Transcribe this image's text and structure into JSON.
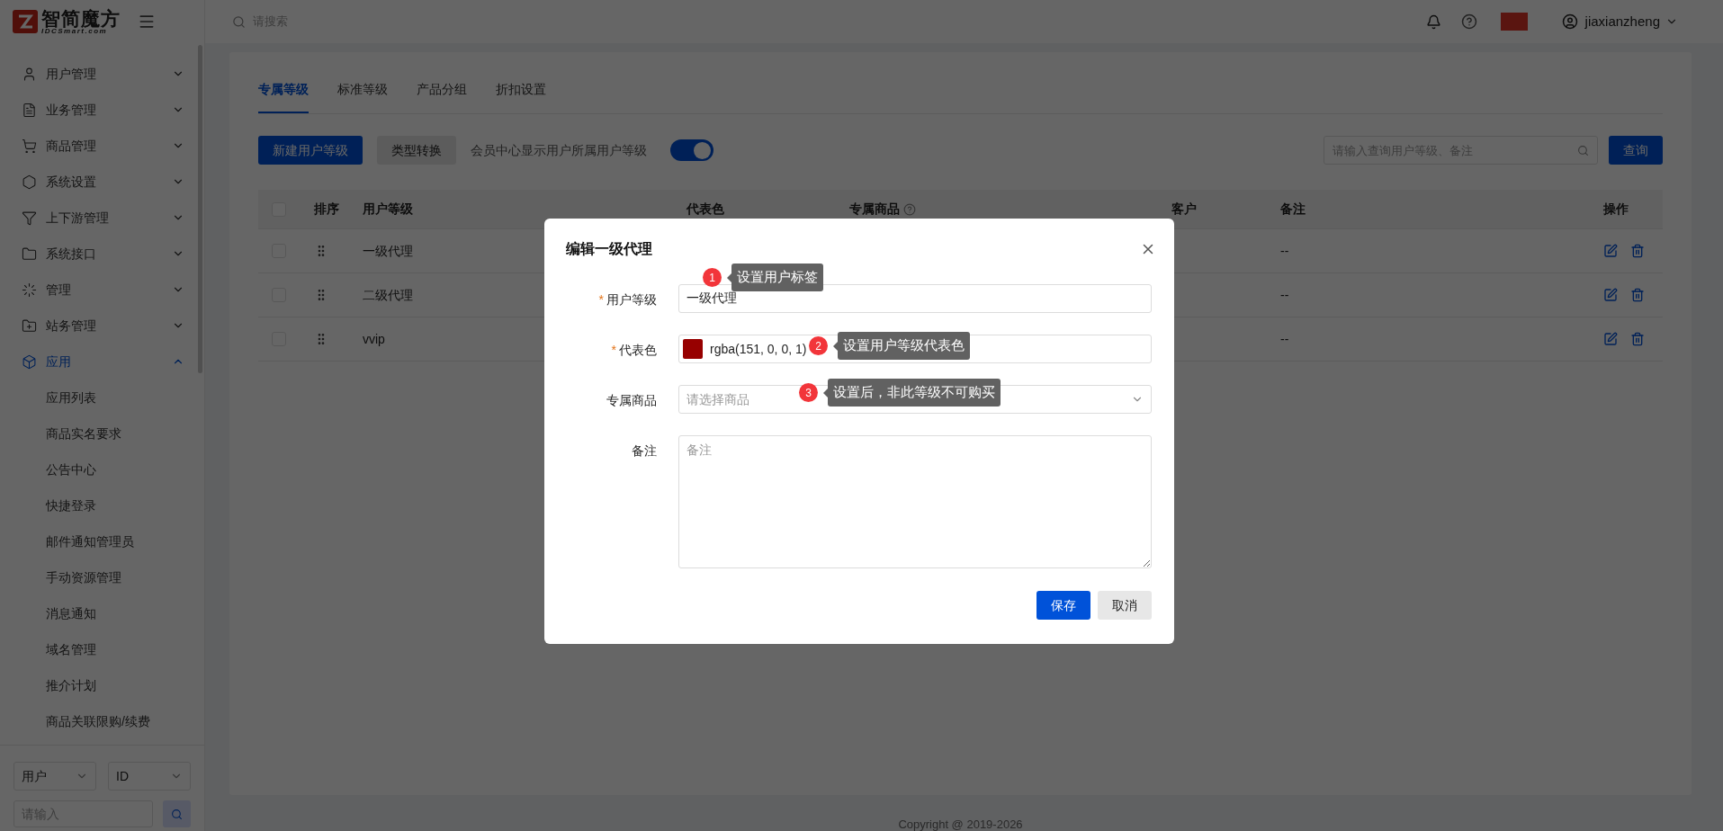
{
  "header": {
    "logo_text": "智简魔方",
    "logo_subtext": "IDCSmart.com",
    "search_placeholder": "请搜索",
    "username": "jiaxianzheng"
  },
  "sidebar": {
    "items": [
      {
        "kind": "user",
        "label": "用户管理",
        "expanded": false,
        "selected": false
      },
      {
        "kind": "list",
        "label": "业务管理",
        "expanded": false,
        "selected": false
      },
      {
        "kind": "cart",
        "label": "商品管理",
        "expanded": false,
        "selected": false
      },
      {
        "kind": "gear",
        "label": "系统设置",
        "expanded": false,
        "selected": false
      },
      {
        "kind": "filter",
        "label": "上下游管理",
        "expanded": false,
        "selected": false
      },
      {
        "kind": "folder",
        "label": "系统接口",
        "expanded": false,
        "selected": false
      },
      {
        "kind": "burst",
        "label": "管理",
        "expanded": false,
        "selected": false
      },
      {
        "kind": "folder-plus",
        "label": "站务管理",
        "expanded": false,
        "selected": false
      },
      {
        "kind": "cube",
        "label": "应用",
        "expanded": true,
        "selected": true,
        "children": [
          {
            "label": "应用列表",
            "selected": false
          },
          {
            "label": "商品实名要求",
            "selected": false
          },
          {
            "label": "公告中心",
            "selected": false
          },
          {
            "label": "快捷登录",
            "selected": false
          },
          {
            "label": "邮件通知管理员",
            "selected": false
          },
          {
            "label": "手动资源管理",
            "selected": false
          },
          {
            "label": "消息通知",
            "selected": false
          },
          {
            "label": "域名管理",
            "selected": false
          },
          {
            "label": "推介计划",
            "selected": false
          },
          {
            "label": "商品关联限购/续费",
            "selected": false
          }
        ]
      }
    ],
    "filter_type": "用户",
    "filter_field": "ID",
    "filter_placeholder": "请输入"
  },
  "tabs": [
    {
      "label": "专属等级",
      "selected": true
    },
    {
      "label": "标准等级",
      "selected": false
    },
    {
      "label": "产品分组",
      "selected": false
    },
    {
      "label": "折扣设置",
      "selected": false
    }
  ],
  "toolbar": {
    "new_button": "新建用户等级",
    "convert_button": "类型转换",
    "toggle_label": "会员中心显示用户所属用户等级",
    "toggle_on": true,
    "search_placeholder": "请输入查询用户等级、备注",
    "query_button": "查询"
  },
  "table": {
    "header_checked": false,
    "columns": [
      {
        "label": "排序",
        "help": false
      },
      {
        "label": "用户等级",
        "help": false
      },
      {
        "label": "代表色",
        "help": false
      },
      {
        "label": "专属商品",
        "help": true
      },
      {
        "label": "客户",
        "help": false
      },
      {
        "label": "备注",
        "help": false
      },
      {
        "label": "操作",
        "help": false
      }
    ],
    "rows": [
      {
        "checked": false,
        "name": "一级代理",
        "note": "--"
      },
      {
        "checked": false,
        "name": "二级代理",
        "note": "--"
      },
      {
        "checked": false,
        "name": "vvip",
        "note": "--"
      }
    ]
  },
  "footer": "Copyright @ 2019-2026",
  "modal": {
    "title": "编辑一级代理",
    "fields": [
      {
        "kind": "input",
        "label": "用户等级",
        "required_mark": "*",
        "value": "一级代理",
        "hint": {
          "number": "1",
          "text": "设置用户标签"
        }
      },
      {
        "kind": "color",
        "label": "代表色",
        "required_mark": "*",
        "color": "#970000",
        "value": "rgba(151, 0, 0, 1)",
        "hint": {
          "number": "2",
          "text": "设置用户等级代表色"
        }
      },
      {
        "kind": "select",
        "label": "专属商品",
        "placeholder": "请选择商品",
        "hint": {
          "number": "3",
          "text": "设置后，非此等级不可购买"
        }
      },
      {
        "kind": "textarea",
        "label": "备注",
        "placeholder": "备注"
      }
    ],
    "save_button": "保存",
    "cancel_button": "取消"
  }
}
